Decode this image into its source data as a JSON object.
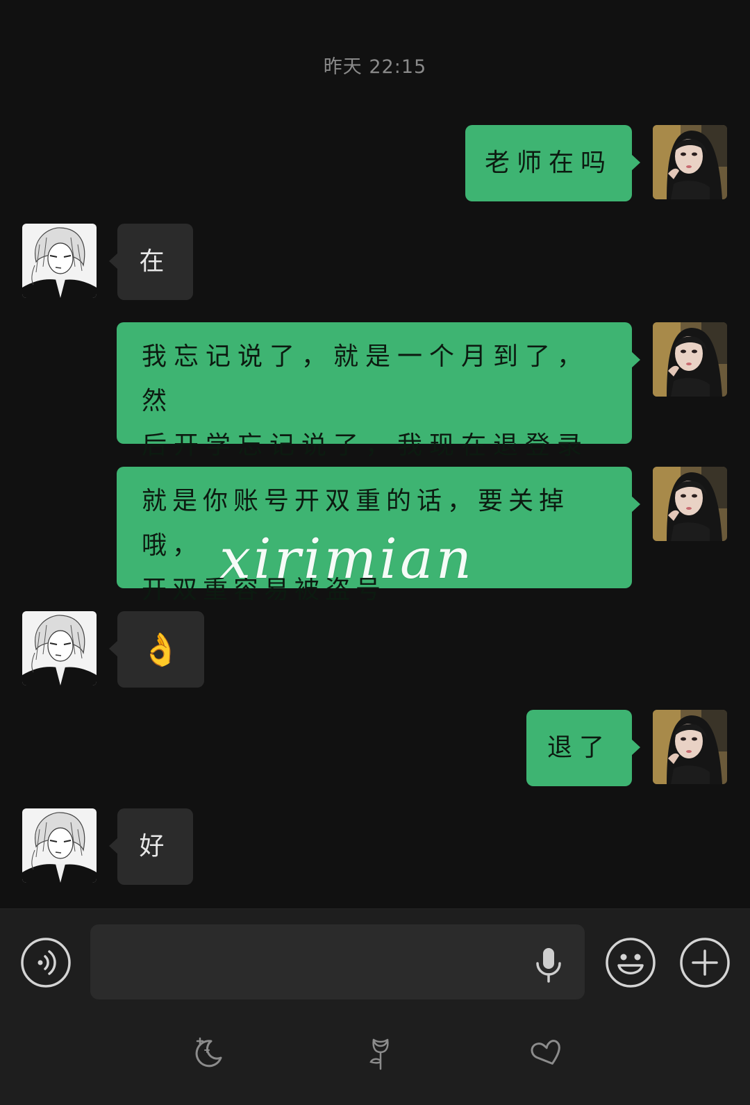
{
  "timestamp": "昨天 22:15",
  "messages": [
    {
      "side": "out",
      "text": "老师在吗"
    },
    {
      "side": "in",
      "text": "在"
    },
    {
      "side": "out",
      "lines": [
        "我忘记说了，就是一个月到了，然",
        "后开学忘记说了，我现在退登录"
      ]
    },
    {
      "side": "out",
      "lines": [
        "就是你账号开双重的话，要关掉哦，",
        "开双重容易被盗号"
      ]
    },
    {
      "side": "in",
      "text": "👌"
    },
    {
      "side": "out",
      "text": "退了"
    },
    {
      "side": "in",
      "text": "好"
    }
  ],
  "watermark": "xirimian",
  "input": {
    "value": "",
    "voice_icon": "voice-toggle-icon",
    "mic_icon": "microphone-icon",
    "emoji_icon": "emoji-icon",
    "plus_icon": "plus-icon"
  },
  "bottom_icons": [
    "moon-sparkle-icon",
    "rose-icon",
    "heart-icon"
  ],
  "colors": {
    "background": "#111111",
    "outgoing_bubble": "#3eb472",
    "incoming_bubble": "#2b2b2b",
    "input_bar": "#1e1e1e"
  }
}
